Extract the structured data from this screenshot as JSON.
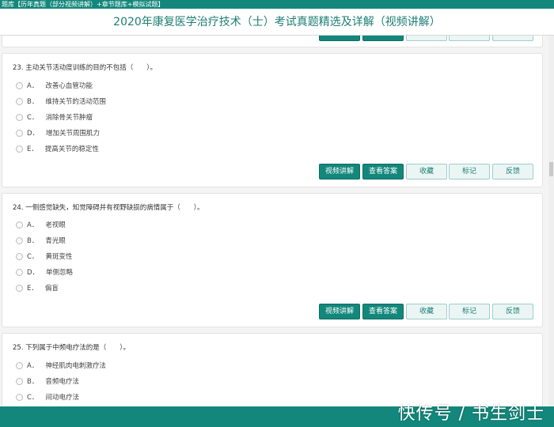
{
  "topbar": {
    "text": "題库【历年真题（部分视频讲解）+章节题库+模拟试题】"
  },
  "title": "2020年康复医学治疗技术（士）考试真题精选及详解（视频讲解）",
  "buttons": {
    "video": "视频讲解",
    "answer": "查看答案",
    "collect": "收藏",
    "mark": "标记",
    "feedback": "反馈"
  },
  "questions": [
    {
      "text": "23. 主动关节活动度训练的目的不包括（　　）。",
      "options": [
        {
          "letter": "A．",
          "text": "改善心血管功能"
        },
        {
          "letter": "B．",
          "text": "维持关节的活动范围"
        },
        {
          "letter": "C．",
          "text": "消除骨关节肿瘤"
        },
        {
          "letter": "D．",
          "text": "增加关节周围肌力"
        },
        {
          "letter": "E．",
          "text": "提高关节的稳定性"
        }
      ]
    },
    {
      "text": "24. 一侧感觉缺失，知觉障碍并有视野缺损的病情属于（　　）。",
      "options": [
        {
          "letter": "A．",
          "text": "老视眼"
        },
        {
          "letter": "B．",
          "text": "青光眼"
        },
        {
          "letter": "C．",
          "text": "黄斑变性"
        },
        {
          "letter": "D．",
          "text": "单侧忽略"
        },
        {
          "letter": "E．",
          "text": "偏盲"
        }
      ]
    },
    {
      "text": "25. 下列属于中频电疗法的是（　　）。",
      "options": [
        {
          "letter": "A．",
          "text": "神经肌肉电刺激疗法"
        },
        {
          "letter": "B．",
          "text": "音频电疗法"
        },
        {
          "letter": "C．",
          "text": "间动电疗法"
        }
      ]
    }
  ],
  "watermark": "快传号 / 书生剑士"
}
